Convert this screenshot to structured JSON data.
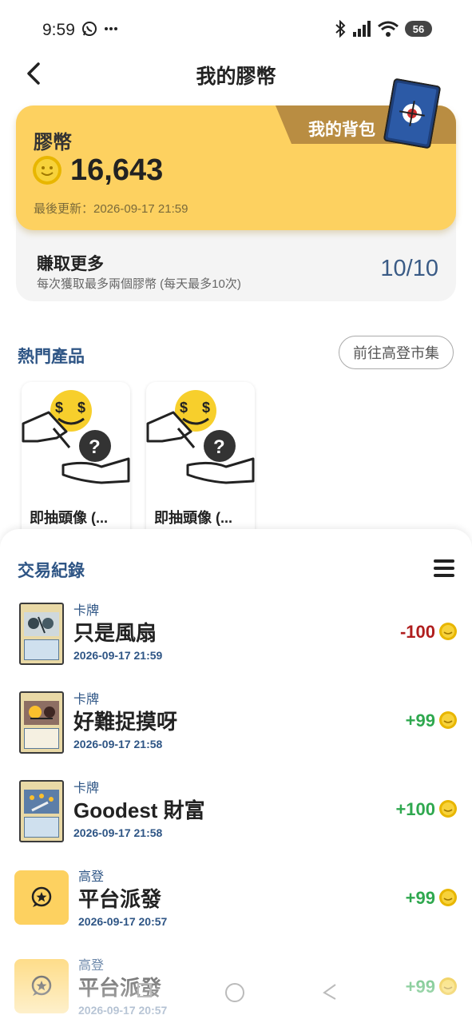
{
  "status": {
    "time": "9:59",
    "battery": "56"
  },
  "header": {
    "title": "我的膠幣"
  },
  "coins": {
    "label": "膠幣",
    "amount": "16,643",
    "updated": "最後更新：2026-09-17 21:59",
    "bag_label": "我的背包"
  },
  "earn": {
    "title": "賺取更多",
    "subtitle": "每次獲取最多兩個膠幣 (每天最多10次)",
    "count": "10/10"
  },
  "hot": {
    "title": "熱門產品",
    "market_button": "前往高登市集",
    "products": [
      {
        "name": "即抽頭像 (..."
      },
      {
        "name": "即抽頭像 (..."
      }
    ]
  },
  "transactions": {
    "title": "交易紀錄",
    "items": [
      {
        "category": "卡牌",
        "name": "只是風扇",
        "date": "2026-09-17 21:59",
        "amount": "-100"
      },
      {
        "category": "卡牌",
        "name": "好難捉摸呀",
        "date": "2026-09-17 21:58",
        "amount": "+99"
      },
      {
        "category": "卡牌",
        "name": "Goodest 財富",
        "date": "2026-09-17 21:58",
        "amount": "+100"
      },
      {
        "category": "高登",
        "name": "平台派發",
        "date": "2026-09-17 20:57",
        "amount": "+99"
      },
      {
        "category": "高登",
        "name": "平台派發",
        "date": "2026-09-17 20:57",
        "amount": "+99"
      }
    ]
  },
  "colors": {
    "accent_yellow": "#fdd160",
    "title_blue": "#2e5585",
    "negative": "#b01e1e",
    "positive": "#2fa84f"
  }
}
